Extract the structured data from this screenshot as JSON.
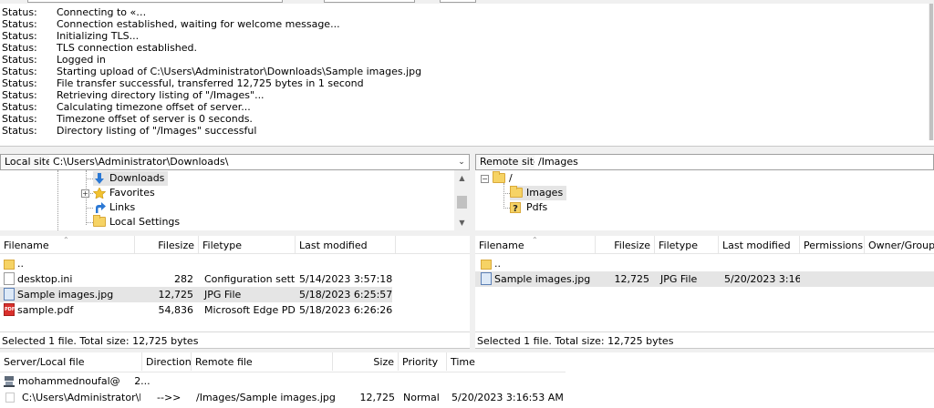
{
  "log": {
    "rows": [
      {
        "key": "Status:",
        "value": "Connecting to «…"
      },
      {
        "key": "Status:",
        "value": "Connection established, waiting for welcome message..."
      },
      {
        "key": "Status:",
        "value": "Initializing TLS..."
      },
      {
        "key": "Status:",
        "value": "TLS connection established."
      },
      {
        "key": "Status:",
        "value": "Logged in"
      },
      {
        "key": "Status:",
        "value": "Starting upload of C:\\Users\\Administrator\\Downloads\\Sample images.jpg"
      },
      {
        "key": "Status:",
        "value": "File transfer successful, transferred 12,725 bytes in 1 second"
      },
      {
        "key": "Status:",
        "value": "Retrieving directory listing of \"/Images\"..."
      },
      {
        "key": "Status:",
        "value": "Calculating timezone offset of server..."
      },
      {
        "key": "Status:",
        "value": "Timezone offset of server is 0 seconds."
      },
      {
        "key": "Status:",
        "value": "Directory listing of \"/Images\" successful"
      }
    ]
  },
  "local": {
    "site_label": "Local site:",
    "path": "C:\\Users\\Administrator\\Downloads\\",
    "tree": [
      "Downloads",
      "Favorites",
      "Links",
      "Local Settings"
    ],
    "columns": {
      "filename": "Filename",
      "filesize": "Filesize",
      "filetype": "Filetype",
      "modified": "Last modified"
    },
    "files": [
      {
        "name": "..",
        "size": "",
        "type": "",
        "modified": ""
      },
      {
        "name": "desktop.ini",
        "size": "282",
        "type": "Configuration setti...",
        "modified": "5/14/2023 3:57:18 ..."
      },
      {
        "name": "Sample images.jpg",
        "size": "12,725",
        "type": "JPG File",
        "modified": "5/18/2023 6:25:57 ..."
      },
      {
        "name": "sample.pdf",
        "size": "54,836",
        "type": "Microsoft Edge PD...",
        "modified": "5/18/2023 6:26:26 ..."
      }
    ],
    "status": "Selected 1 file. Total size: 12,725 bytes"
  },
  "remote": {
    "site_label": "Remote site:",
    "path": "/Images",
    "tree": [
      "/",
      "Images",
      "Pdfs"
    ],
    "columns": {
      "filename": "Filename",
      "filesize": "Filesize",
      "filetype": "Filetype",
      "modified": "Last modified",
      "permissions": "Permissions",
      "owner": "Owner/Group"
    },
    "files": [
      {
        "name": "..",
        "size": "",
        "type": "",
        "modified": ""
      },
      {
        "name": "Sample images.jpg",
        "size": "12,725",
        "type": "JPG File",
        "modified": "5/20/2023 3:16:..."
      }
    ],
    "status": "Selected 1 file. Total size: 12,725 bytes"
  },
  "queue": {
    "columns": {
      "file": "Server/Local file",
      "direction": "Direction",
      "remote": "Remote file",
      "size": "Size",
      "priority": "Priority",
      "time": "Time"
    },
    "server": "mohammednoufal@",
    "server_extra": "2...",
    "item": {
      "local": "C:\\Users\\Administrator\\D...",
      "direction": "-->>",
      "remote": "/Images/Sample images.jpg",
      "size": "12,725",
      "priority": "Normal",
      "time": "5/20/2023 3:16:53 AM"
    }
  }
}
